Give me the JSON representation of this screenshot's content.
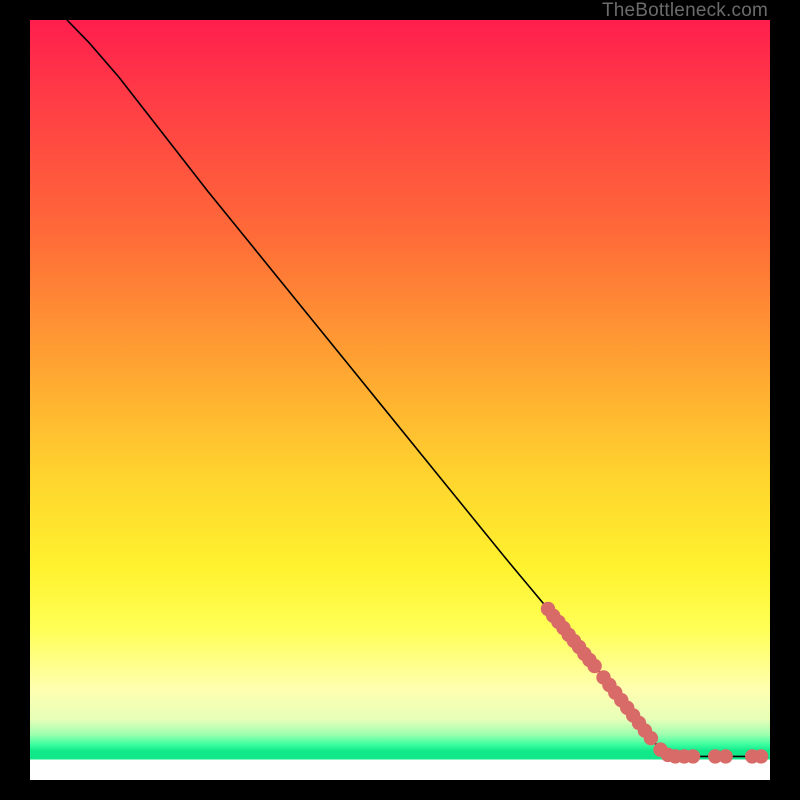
{
  "watermark": "TheBottleneck.com",
  "colors": {
    "marker": "#d86a68",
    "curve": "#000000",
    "gradient_top": "#ff1e4d",
    "gradient_bottom": "#10e889"
  },
  "chart_data": {
    "type": "line",
    "title": "",
    "xlabel": "",
    "ylabel": "",
    "xlim": [
      0,
      100
    ],
    "ylim": [
      0,
      100
    ],
    "note": "Axes have no visible ticks or labels; values are normalized 0–100 to plot area. Curve depicts bottleneck % descending from ~100 at x≈5 to 0 near x≈86, then flat at 0.",
    "curve": [
      {
        "x": 5.0,
        "y": 100.0
      },
      {
        "x": 8.0,
        "y": 97.0
      },
      {
        "x": 12.0,
        "y": 92.5
      },
      {
        "x": 16.0,
        "y": 87.5
      },
      {
        "x": 24.0,
        "y": 77.5
      },
      {
        "x": 34.0,
        "y": 65.5
      },
      {
        "x": 44.0,
        "y": 53.5
      },
      {
        "x": 54.0,
        "y": 41.5
      },
      {
        "x": 64.0,
        "y": 29.5
      },
      {
        "x": 70.0,
        "y": 22.5
      },
      {
        "x": 74.0,
        "y": 17.8
      },
      {
        "x": 78.0,
        "y": 13.0
      },
      {
        "x": 82.0,
        "y": 8.0
      },
      {
        "x": 85.0,
        "y": 4.2
      },
      {
        "x": 86.5,
        "y": 3.1
      },
      {
        "x": 88.0,
        "y": 3.1
      },
      {
        "x": 92.0,
        "y": 3.1
      },
      {
        "x": 96.0,
        "y": 3.1
      },
      {
        "x": 99.0,
        "y": 3.1
      }
    ],
    "series": [
      {
        "name": "markers",
        "points": [
          {
            "x": 70.0,
            "y": 22.5
          },
          {
            "x": 70.7,
            "y": 21.6
          },
          {
            "x": 71.4,
            "y": 20.8
          },
          {
            "x": 72.1,
            "y": 20.0
          },
          {
            "x": 72.8,
            "y": 19.1
          },
          {
            "x": 73.5,
            "y": 18.3
          },
          {
            "x": 74.2,
            "y": 17.5
          },
          {
            "x": 74.9,
            "y": 16.6
          },
          {
            "x": 75.6,
            "y": 15.8
          },
          {
            "x": 76.3,
            "y": 15.0
          },
          {
            "x": 77.5,
            "y": 13.5
          },
          {
            "x": 78.3,
            "y": 12.5
          },
          {
            "x": 79.1,
            "y": 11.5
          },
          {
            "x": 79.9,
            "y": 10.5
          },
          {
            "x": 80.7,
            "y": 9.5
          },
          {
            "x": 81.5,
            "y": 8.5
          },
          {
            "x": 82.3,
            "y": 7.5
          },
          {
            "x": 83.1,
            "y": 6.5
          },
          {
            "x": 83.9,
            "y": 5.5
          },
          {
            "x": 85.2,
            "y": 4.0
          },
          {
            "x": 86.2,
            "y": 3.3
          },
          {
            "x": 87.2,
            "y": 3.1
          },
          {
            "x": 88.4,
            "y": 3.1
          },
          {
            "x": 89.6,
            "y": 3.1
          },
          {
            "x": 92.6,
            "y": 3.1
          },
          {
            "x": 94.0,
            "y": 3.1
          },
          {
            "x": 97.6,
            "y": 3.1
          },
          {
            "x": 98.8,
            "y": 3.1
          }
        ]
      }
    ]
  }
}
